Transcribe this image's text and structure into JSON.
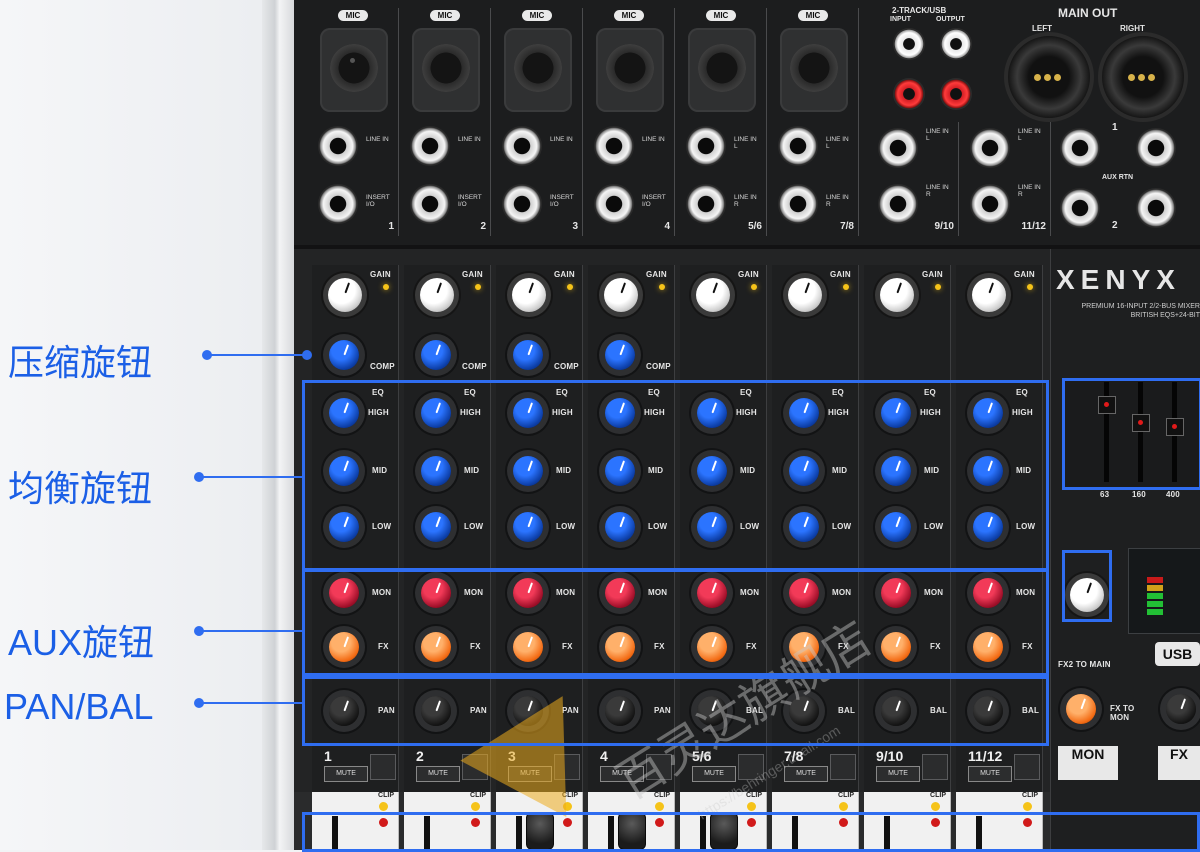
{
  "annotations": [
    {
      "id": "compressor",
      "text": "压缩旋钮"
    },
    {
      "id": "eq",
      "text": "均衡旋钮"
    },
    {
      "id": "aux",
      "text": "AUX旋钮"
    },
    {
      "id": "panbal",
      "text": "PAN/BAL"
    }
  ],
  "channels": [
    {
      "num": "1",
      "mic": "MIC",
      "line1": "LINE IN",
      "line2": "INSERT\nI/O"
    },
    {
      "num": "2",
      "mic": "MIC",
      "line1": "LINE IN",
      "line2": "INSERT\nI/O"
    },
    {
      "num": "3",
      "mic": "MIC",
      "line1": "LINE IN",
      "line2": "INSERT\nI/O"
    },
    {
      "num": "4",
      "mic": "MIC",
      "line1": "LINE IN",
      "line2": "INSERT\nI/O"
    },
    {
      "num": "5/6",
      "mic": "MIC",
      "line1": "LINE IN\nL",
      "line2": "LINE IN\nR"
    },
    {
      "num": "7/8",
      "mic": "MIC",
      "line1": "LINE IN\nL",
      "line2": "LINE IN\nR"
    },
    {
      "num": "9/10",
      "line1": "LINE IN\nL",
      "line2": "LINE IN\nR"
    },
    {
      "num": "11/12",
      "line1": "LINE IN\nL",
      "line2": "LINE IN\nR"
    }
  ],
  "top_right": {
    "two_track": "2-TRACK/USB",
    "input": "INPUT",
    "output": "OUTPUT",
    "main_out": "MAIN OUT",
    "left": "LEFT",
    "right": "RIGHT",
    "aux_rtn": "AUX RTN",
    "one": "1",
    "two": "2",
    "line_in": "LINE IN"
  },
  "controls": {
    "gain": "GAIN",
    "comp": "COMP",
    "eq": "EQ",
    "high": "HIGH",
    "mid": "MID",
    "low": "LOW",
    "mon": "MON",
    "fx": "FX",
    "pan": "PAN",
    "bal": "BAL",
    "mute": "MUTE",
    "mute2": "MUTE",
    "clip": "CLIP"
  },
  "brand": {
    "logo": "XENYX",
    "sub": "PREMIUM 16-INPUT 2/2-BUS MIXER\nBRITISH EQS+24-BIT"
  },
  "right_panel": {
    "usb": "USB",
    "fx_to_mon": "FX TO\nMON",
    "fx_to_main": "FX2 TO MAIN",
    "mon": "MON",
    "fx": "FX",
    "geq_freqs": [
      "63",
      "160",
      "400"
    ]
  },
  "watermark": {
    "text": "百灵达旗舰店",
    "url": "https://behringer.tmall.com"
  },
  "colors": {
    "annotation": "#2f6df0"
  }
}
